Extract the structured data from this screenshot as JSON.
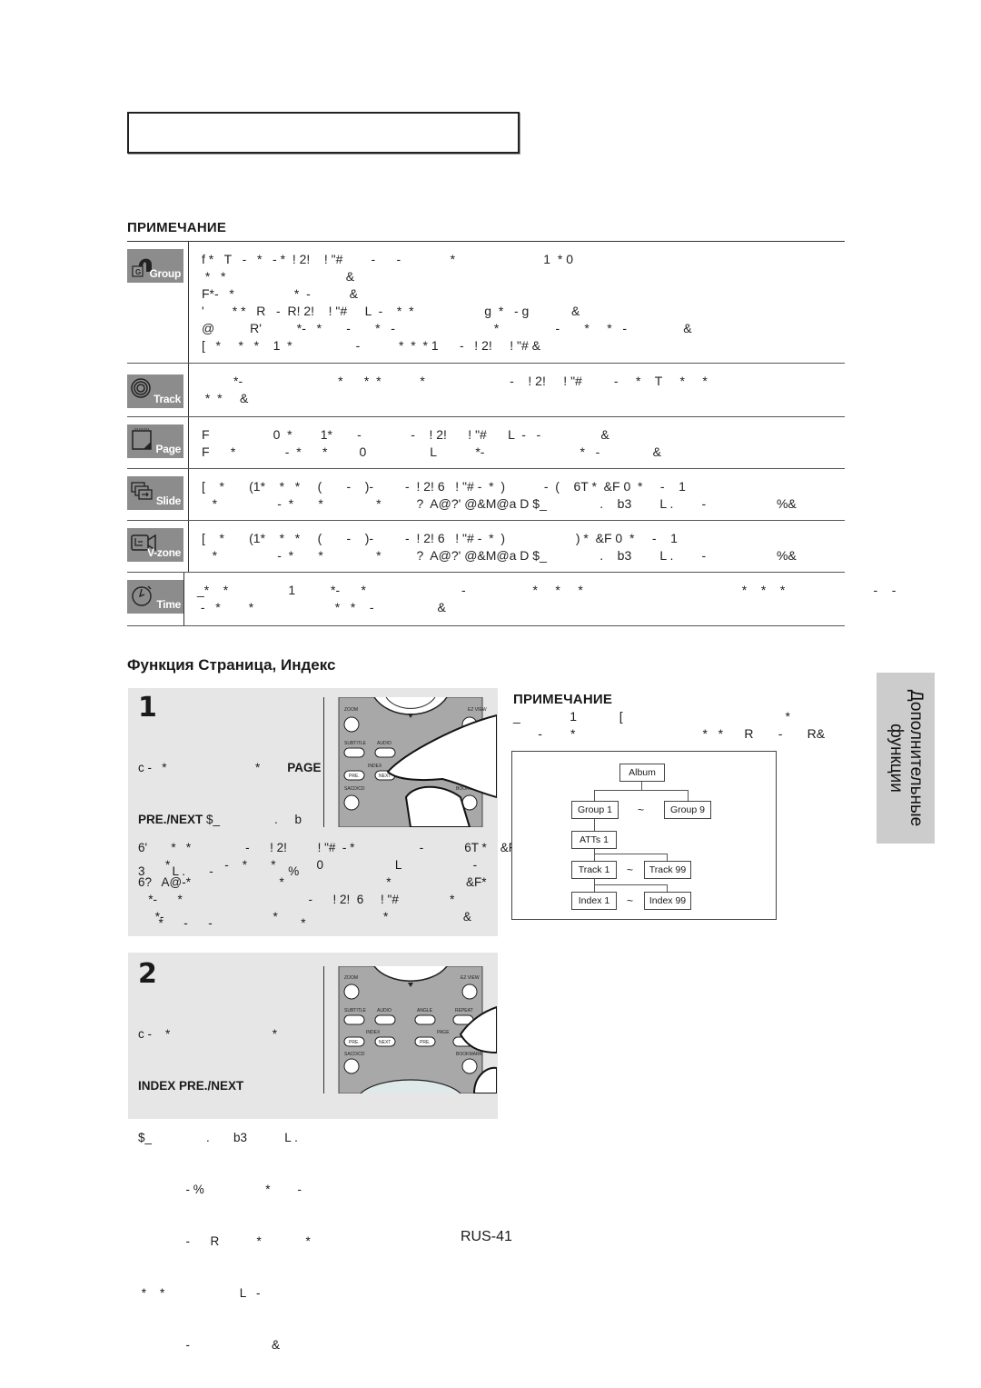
{
  "page": {
    "title_box_text": "",
    "page_number": "RUS-41",
    "side_tab": {
      "line1": "Дополнительные",
      "line2": "функции"
    }
  },
  "notes": {
    "heading": "ПРИМЕЧАНИЕ",
    "rows": [
      {
        "icon": "group-icon",
        "icon_label": "Group",
        "text": "f *   T   -   *   - *  ! 2!    ! \"#        -      -              *                         1  * 0\n *   *                                  &\nF*-   *                 *  -           &\n'        * *   R   -  R! 2!    ! \"#     L  -    *  *                    g  *   - g            &\n@          R'          *-   *       -       *   -                            *                -       *     *   -                &\n[   *     *   *    1  *                  -           *  *  * 1      -   ! 2!     ! \"# &"
      },
      {
        "icon": "track-icon",
        "icon_label": "Track",
        "text": "         *-                           *      *  *           *                        -    ! 2!     ! \"#         -     *    T     *     *\n *  *     &"
      },
      {
        "icon": "page-icon",
        "icon_label": "Page",
        "text": "F                  0  *        1*       -              -    ! 2!      ! \"#      L  -   -                 &\nF      *              -  *      *         0                  L           *-                           *   -               &"
      },
      {
        "icon": "slide-icon",
        "icon_label": "Slide",
        "text": "[    *       (1*    *   *     (       -    )-         -  ! 2! 6   ! \"# -  *  )           -  (    6T *  &F 0  *     -    1\n   *                 -  *       *               *          ?  A@?' @&M@a D $_               .    b3        L .        -                    %&"
      },
      {
        "icon": "vzone-icon",
        "icon_label": "V-zone",
        "text": "[    *       (1*    *   *     (       -    )-         -  ! 2! 6   ! \"# -  *  )                    ) *  &F 0  *     -    1\n   *                 -  *       *               *          ?  A@?' @&M@a D $_               .    b3        L .        -                    %&"
      },
      {
        "icon": "time-icon",
        "icon_label": "Time",
        "text": "_*    *                 1          *-      *                           -                   *     *     *                                             *    *    *                         -    -\n -   *        *                       *   *    -                  &"
      }
    ]
  },
  "section": {
    "title": "Функция Страница, Индекс"
  },
  "steps": [
    {
      "number": "1",
      "text_lines": [
        {
          "plain": "c -   *                          *        ",
          "bold": "PAGE"
        },
        {
          "bold": "PRE./NEXT",
          "plain": " $_                .     b"
        },
        {
          "plain": "3        L .       -                      %"
        },
        {
          "plain": "      *      -      -                          *"
        },
        {
          "plain": "                               -       *     T"
        },
        {
          "plain": "*      *    -                      &"
        }
      ],
      "text_after": "6'       *   *                -      ! 2!         ! \"#  - *                   -            6T *    &F\n        *                -    *       *            0                     L                     -            6T *   &\n6?   A@-*                          *                              *                      &F*\n   *-      *                                     -      ! 2!  6     ! \"#               *\n     *-                                *                               *                      &",
      "remote": {
        "buttons": [
          "ZOOM",
          "EZ VIEW",
          "SUBTITLE",
          "AUDIO",
          "PRE.",
          "NEXT",
          "PRE.",
          "NEXT",
          "SACD/CD",
          "BOOKMARK"
        ],
        "group_label": "INDEX"
      }
    },
    {
      "number": "2",
      "text_lines": [
        {
          "plain": "c -    *                              *"
        },
        {
          "bold": "INDEX PRE./NEXT"
        },
        {
          "plain": "$_                .       b3           L ."
        },
        {
          "plain": "              - %                  *        -"
        },
        {
          "plain": "              -      R           *             *"
        },
        {
          "plain": " *    *                      L   -"
        },
        {
          "plain": "              -                        &"
        }
      ],
      "remote": {
        "buttons": [
          "ZOOM",
          "EZ VIEW",
          "SUBTITLE",
          "AUDIO",
          "ANGLE",
          "REPEAT",
          "PRE.",
          "NEXT",
          "PRE.",
          "NEXT",
          "SACD/CD",
          "BOOKMARK"
        ],
        "group_label": "INDEX",
        "group_label_2": "PAGE"
      }
    }
  ],
  "side_note": {
    "heading": "ПРИМЕЧАНИЕ",
    "text": "_              1            [                                              *\n       -        *                                    *   *      R       -       R&"
  },
  "diagram": {
    "album": "Album",
    "group_first": "Group 1",
    "group_last": "Group 9",
    "atts": "ATTs 1",
    "track_first": "Track 1",
    "track_last": "Track 99",
    "index_first": "Index 1",
    "index_last": "Index 99",
    "range_symbol": "~"
  },
  "colors": {
    "panel_gray": "#e6e6e6",
    "icon_gray": "#8c8c8c",
    "side_tab_gray": "#cccccc"
  }
}
